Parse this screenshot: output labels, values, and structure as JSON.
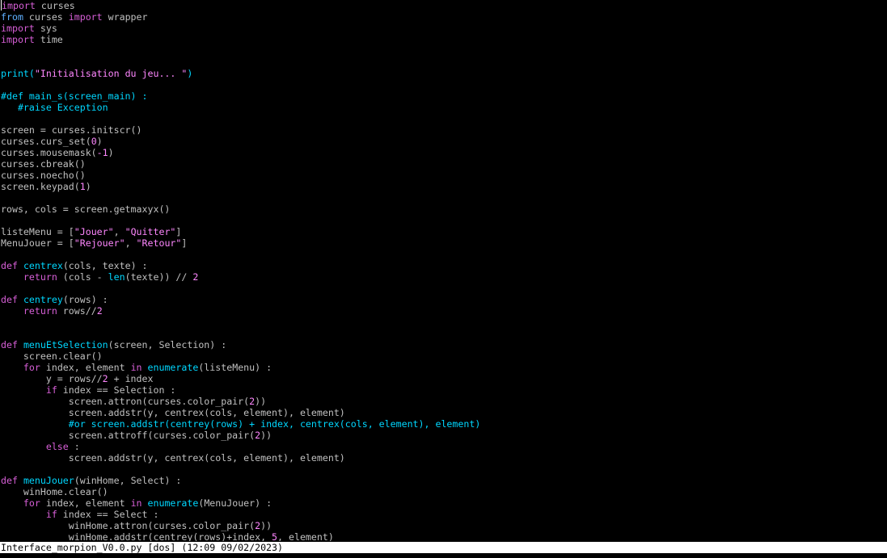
{
  "editor": {
    "lines": [
      [
        {
          "t": "import",
          "c": "kw2"
        },
        {
          "t": " curses",
          "c": "plain"
        }
      ],
      [
        {
          "t": "from",
          "c": "kw"
        },
        {
          "t": " curses ",
          "c": "plain"
        },
        {
          "t": "import",
          "c": "kw2"
        },
        {
          "t": " wrapper",
          "c": "plain"
        }
      ],
      [
        {
          "t": "import",
          "c": "kw2"
        },
        {
          "t": " sys",
          "c": "plain"
        }
      ],
      [
        {
          "t": "import",
          "c": "kw2"
        },
        {
          "t": " time",
          "c": "plain"
        }
      ],
      [],
      [],
      [
        {
          "t": "print",
          "c": "builtin"
        },
        {
          "t": "(",
          "c": "builtin"
        },
        {
          "t": "\"Initialisation du jeu... \"",
          "c": "str"
        },
        {
          "t": ")",
          "c": "builtin"
        }
      ],
      [],
      [
        {
          "t": "#def main_s(screen_main) :",
          "c": "com"
        }
      ],
      [
        {
          "t": "   #raise Exception",
          "c": "com"
        }
      ],
      [],
      [
        {
          "t": "screen = curses.initscr()",
          "c": "plain"
        }
      ],
      [
        {
          "t": "curses.curs_set(",
          "c": "plain"
        },
        {
          "t": "0",
          "c": "num"
        },
        {
          "t": ")",
          "c": "plain"
        }
      ],
      [
        {
          "t": "curses.mousemask(",
          "c": "plain"
        },
        {
          "t": "-1",
          "c": "num"
        },
        {
          "t": ")",
          "c": "plain"
        }
      ],
      [
        {
          "t": "curses.cbreak()",
          "c": "plain"
        }
      ],
      [
        {
          "t": "curses.noecho()",
          "c": "plain"
        }
      ],
      [
        {
          "t": "screen.keypad(",
          "c": "plain"
        },
        {
          "t": "1",
          "c": "num"
        },
        {
          "t": ")",
          "c": "plain"
        }
      ],
      [],
      [
        {
          "t": "rows, cols = screen.getmaxyx()",
          "c": "plain"
        }
      ],
      [],
      [
        {
          "t": "listeMenu = [",
          "c": "plain"
        },
        {
          "t": "\"Jouer\"",
          "c": "str"
        },
        {
          "t": ", ",
          "c": "plain"
        },
        {
          "t": "\"Quitter\"",
          "c": "str"
        },
        {
          "t": "]",
          "c": "plain"
        }
      ],
      [
        {
          "t": "MenuJouer = [",
          "c": "plain"
        },
        {
          "t": "\"Rejouer\"",
          "c": "str"
        },
        {
          "t": ", ",
          "c": "plain"
        },
        {
          "t": "\"Retour\"",
          "c": "str"
        },
        {
          "t": "]",
          "c": "plain"
        }
      ],
      [],
      [
        {
          "t": "def",
          "c": "kw2"
        },
        {
          "t": " ",
          "c": "plain"
        },
        {
          "t": "centrex",
          "c": "fn"
        },
        {
          "t": "(cols, texte) :",
          "c": "plain"
        }
      ],
      [
        {
          "t": "    ",
          "c": "plain"
        },
        {
          "t": "return",
          "c": "kw2"
        },
        {
          "t": " (cols - ",
          "c": "plain"
        },
        {
          "t": "len",
          "c": "builtin"
        },
        {
          "t": "(texte)) // ",
          "c": "plain"
        },
        {
          "t": "2",
          "c": "num"
        }
      ],
      [],
      [
        {
          "t": "def",
          "c": "kw2"
        },
        {
          "t": " ",
          "c": "plain"
        },
        {
          "t": "centrey",
          "c": "fn"
        },
        {
          "t": "(rows) :",
          "c": "plain"
        }
      ],
      [
        {
          "t": "    ",
          "c": "plain"
        },
        {
          "t": "return",
          "c": "kw2"
        },
        {
          "t": " rows//",
          "c": "plain"
        },
        {
          "t": "2",
          "c": "num"
        }
      ],
      [],
      [],
      [
        {
          "t": "def",
          "c": "kw2"
        },
        {
          "t": " ",
          "c": "plain"
        },
        {
          "t": "menuEtSelection",
          "c": "fn"
        },
        {
          "t": "(screen, Selection) :",
          "c": "plain"
        }
      ],
      [
        {
          "t": "    screen.clear()",
          "c": "plain"
        }
      ],
      [
        {
          "t": "    ",
          "c": "plain"
        },
        {
          "t": "for",
          "c": "kw2"
        },
        {
          "t": " index, element ",
          "c": "plain"
        },
        {
          "t": "in",
          "c": "kw2"
        },
        {
          "t": " ",
          "c": "plain"
        },
        {
          "t": "enumerate",
          "c": "builtin"
        },
        {
          "t": "(listeMenu) :",
          "c": "plain"
        }
      ],
      [
        {
          "t": "        y = rows//",
          "c": "plain"
        },
        {
          "t": "2",
          "c": "num"
        },
        {
          "t": " + index",
          "c": "plain"
        }
      ],
      [
        {
          "t": "        ",
          "c": "plain"
        },
        {
          "t": "if",
          "c": "kw2"
        },
        {
          "t": " index == Selection :",
          "c": "plain"
        }
      ],
      [
        {
          "t": "            screen.attron(curses.color_pair(",
          "c": "plain"
        },
        {
          "t": "2",
          "c": "num"
        },
        {
          "t": "))",
          "c": "plain"
        }
      ],
      [
        {
          "t": "            screen.addstr(y, centrex(cols, element), element)",
          "c": "plain"
        }
      ],
      [
        {
          "t": "            ",
          "c": "plain"
        },
        {
          "t": "#or screen.addstr(centrey(rows) + index, centrex(cols, element), element)",
          "c": "com"
        }
      ],
      [
        {
          "t": "            screen.attroff(curses.color_pair(",
          "c": "plain"
        },
        {
          "t": "2",
          "c": "num"
        },
        {
          "t": "))",
          "c": "plain"
        }
      ],
      [
        {
          "t": "        ",
          "c": "plain"
        },
        {
          "t": "else",
          "c": "kw2"
        },
        {
          "t": " :",
          "c": "plain"
        }
      ],
      [
        {
          "t": "            screen.addstr(y, centrex(cols, element), element)",
          "c": "plain"
        }
      ],
      [],
      [
        {
          "t": "def",
          "c": "kw2"
        },
        {
          "t": " ",
          "c": "plain"
        },
        {
          "t": "menuJouer",
          "c": "fn"
        },
        {
          "t": "(winHome, Select) :",
          "c": "plain"
        }
      ],
      [
        {
          "t": "    winHome.clear()",
          "c": "plain"
        }
      ],
      [
        {
          "t": "    ",
          "c": "plain"
        },
        {
          "t": "for",
          "c": "kw2"
        },
        {
          "t": " index, element ",
          "c": "plain"
        },
        {
          "t": "in",
          "c": "kw2"
        },
        {
          "t": " ",
          "c": "plain"
        },
        {
          "t": "enumerate",
          "c": "builtin"
        },
        {
          "t": "(MenuJouer) :",
          "c": "plain"
        }
      ],
      [
        {
          "t": "        ",
          "c": "plain"
        },
        {
          "t": "if",
          "c": "kw2"
        },
        {
          "t": " index == Select :",
          "c": "plain"
        }
      ],
      [
        {
          "t": "            winHome.attron(curses.color_pair(",
          "c": "plain"
        },
        {
          "t": "2",
          "c": "num"
        },
        {
          "t": "))",
          "c": "plain"
        }
      ],
      [
        {
          "t": "            winHome.addstr(centrey(rows)+index, ",
          "c": "plain"
        },
        {
          "t": "5",
          "c": "num"
        },
        {
          "t": ", element)",
          "c": "plain"
        }
      ]
    ]
  },
  "statusbar": {
    "text": "Interface_morpion_V0.0.py [dos] (12:09 09/02/2023)"
  },
  "colors": {
    "background": "#000000",
    "plain": "#c0c0c0",
    "keyword": "#d75fd7",
    "keyword_from": "#5fafff",
    "function_name": "#00d7ff",
    "string": "#ff87ff",
    "number": "#ff87ff",
    "comment": "#00d7ff",
    "statusbar_bg": "#ffffff",
    "statusbar_fg": "#000000"
  }
}
